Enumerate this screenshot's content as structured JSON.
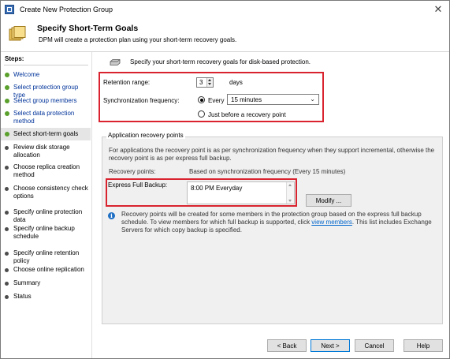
{
  "window": {
    "title": "Create New Protection Group",
    "close_glyph": "✕"
  },
  "header": {
    "title": "Specify Short-Term Goals",
    "subtitle": "DPM will create a protection plan using your short-term recovery goals."
  },
  "steps": {
    "title": "Steps:",
    "items": [
      {
        "label": "Welcome",
        "state": "done"
      },
      {
        "label": "Select protection group type",
        "state": "done"
      },
      {
        "label": "Select group members",
        "state": "done"
      },
      {
        "label": "Select data protection method",
        "state": "done"
      },
      {
        "label": "Select short-term goals",
        "state": "current"
      },
      {
        "label": "Review disk storage allocation",
        "state": "pending"
      },
      {
        "label": "Choose replica creation method",
        "state": "pending"
      },
      {
        "label": "Choose consistency check options",
        "state": "pending"
      },
      {
        "label": "Specify online protection data",
        "state": "pending"
      },
      {
        "label": "Specify online backup schedule",
        "state": "pending"
      },
      {
        "label": "Specify online retention policy",
        "state": "pending"
      },
      {
        "label": "Choose online replication",
        "state": "pending"
      },
      {
        "label": "Summary",
        "state": "pending"
      },
      {
        "label": "Status",
        "state": "pending"
      }
    ]
  },
  "main": {
    "intro": "Specify your short-term recovery goals for disk-based protection.",
    "retention_range_label": "Retention range:",
    "retention_value": "3",
    "retention_unit": "days",
    "sync_label": "Synchronization frequency:",
    "every_label": "Every",
    "every_selected": true,
    "frequency_value": "15 minutes",
    "before_recovery_label": "Just before a recovery point",
    "before_recovery_selected": false
  },
  "recovery_points": {
    "group_title": "Application recovery points",
    "description": "For applications the recovery point is as per synchronization frequency when they support incremental, otherwise the recovery point is as per express full backup.",
    "recovery_points_label": "Recovery points:",
    "recovery_points_value": "Based on synchronization frequency (Every 15 minutes)",
    "express_full_label": "Express Full Backup:",
    "express_full_value": "8:00 PM Everyday",
    "modify_label": "Modify ...",
    "info_text_before": "Recovery points will be created for some members in the protection group based on the express full backup schedule. To view members for which full backup is supported, click ",
    "info_link": "view members",
    "info_text_after": ". This list includes Exchange Servers for which copy backup is specified."
  },
  "footer": {
    "back_label": "< Back",
    "next_label": "Next >",
    "cancel_label": "Cancel",
    "help_label": "Help"
  },
  "colors": {
    "highlight_border": "#d9232e",
    "done_bullet": "#5aa02c",
    "link": "#0066cc"
  }
}
